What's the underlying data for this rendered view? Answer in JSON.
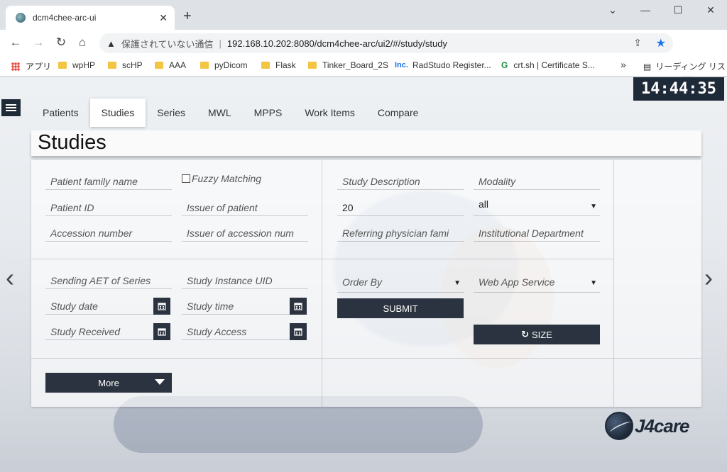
{
  "browser": {
    "tab_title": "dcm4chee-arc-ui",
    "tab_close": "✕",
    "new_tab": "+",
    "window_controls": {
      "minimize": "—",
      "maximize": "☐",
      "close": "✕",
      "restore_menu": "⌄"
    },
    "nav": {
      "back": "←",
      "forward": "→",
      "reload": "↻",
      "home": "⌂"
    },
    "address": {
      "security_text": "保護されていない通信",
      "separator": "|",
      "url": "192.168.10.202:8080/dcm4chee-arc/ui2/#/study/study"
    },
    "bookmarks": [
      {
        "label": "アプリ",
        "kind": "apps"
      },
      {
        "label": "wpHP",
        "kind": "folder"
      },
      {
        "label": "scHP",
        "kind": "folder"
      },
      {
        "label": "AAA",
        "kind": "folder"
      },
      {
        "label": "pyDicom",
        "kind": "folder"
      },
      {
        "label": "Flask",
        "kind": "folder"
      },
      {
        "label": "Tinker_Board_2S",
        "kind": "folder"
      },
      {
        "label": "RadStudo Register...",
        "kind": "inc",
        "prefix": "Inc."
      },
      {
        "label": "crt.sh | Certificate S...",
        "kind": "crt",
        "prefix": "G"
      }
    ],
    "bookmarks_more": "»",
    "reading_list": "リーディング リスト"
  },
  "app": {
    "clock": "14:44:35",
    "tabs": [
      {
        "label": "Patients",
        "active": false
      },
      {
        "label": "Studies",
        "active": true
      },
      {
        "label": "Series",
        "active": false
      },
      {
        "label": "MWL",
        "active": false
      },
      {
        "label": "MPPS",
        "active": false
      },
      {
        "label": "Work Items",
        "active": false
      },
      {
        "label": "Compare",
        "active": false
      }
    ],
    "page_title": "Studies",
    "filters": {
      "patient_family_name": "Patient family name",
      "fuzzy_matching": "Fuzzy Matching",
      "patient_id": "Patient ID",
      "issuer_of_patient": "Issuer of patient",
      "accession_number": "Accession number",
      "issuer_of_accession": "Issuer of accession num",
      "study_description": "Study Description",
      "modality": "Modality",
      "limit_value": "20",
      "all_select": "all",
      "referring_physician": "Referring physician fami",
      "institutional_department": "Institutional Department",
      "sending_aet": "Sending AET of Series",
      "study_instance_uid": "Study Instance UID",
      "study_date": "Study date",
      "study_time": "Study time",
      "study_received": "Study Received",
      "study_access": "Study Access",
      "order_by": "Order By",
      "web_app_service": "Web App Service"
    },
    "buttons": {
      "submit": "SUBMIT",
      "size": "SIZE",
      "more": "More"
    },
    "carousel": {
      "prev": "‹",
      "next": "›"
    },
    "logo_text": "J4care"
  }
}
